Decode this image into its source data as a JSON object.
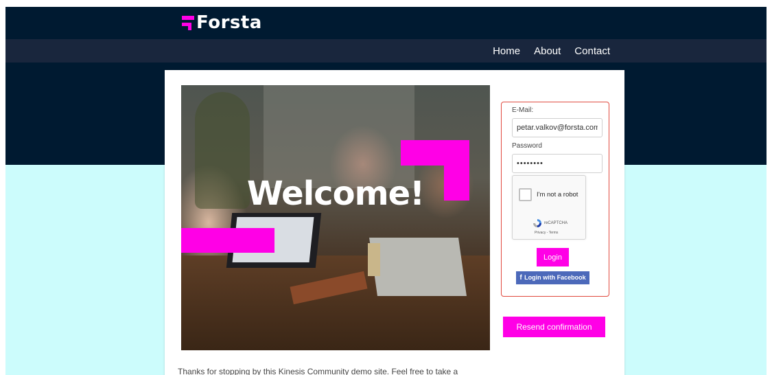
{
  "header": {
    "logo_text": "Forsta",
    "nav": [
      {
        "label": "Home"
      },
      {
        "label": "About"
      },
      {
        "label": "Contact"
      }
    ]
  },
  "hero": {
    "headline": "Welcome!"
  },
  "login": {
    "email_label": "E-Mail:",
    "email_value": "petar.valkov@forsta.com",
    "password_label": "Password",
    "password_value": "••••••••",
    "recaptcha": {
      "label": "I'm not a robot",
      "brand": "reCAPTCHA",
      "links": "Privacy - Terms",
      "checked": false
    },
    "login_label": "Login",
    "facebook_label": "Login with Facebook",
    "resend_label": "Resend confirmation"
  },
  "body_text": "Thanks for stopping by this Kinesis Community demo site. Feel free to take a",
  "colors": {
    "navy": "#001a31",
    "nav_bar": "#19263d",
    "accent_magenta": "#ff00e6",
    "page_bg_light": "#ccfcfc",
    "facebook_blue": "#4c69ba",
    "form_border": "#e0473c"
  },
  "icons": {
    "logo_mark": "forsta-logo-mark",
    "recaptcha": "recaptcha-logo-icon",
    "facebook": "facebook-f-icon"
  }
}
